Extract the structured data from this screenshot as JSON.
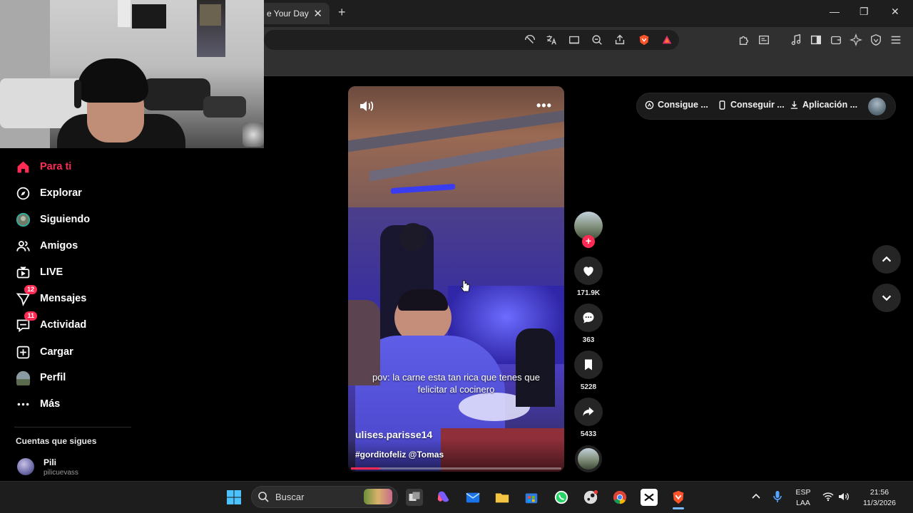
{
  "browser": {
    "tab_title": "e Your Day",
    "tab_close": "✕",
    "new_tab": "+",
    "window_controls": {
      "minimize": "—",
      "restore": "❐",
      "close": "✕"
    },
    "toolbar_icons": [
      "no-translate-icon",
      "translate-icon",
      "cast-icon",
      "zoom-icon",
      "share-icon",
      "brave-shields-icon",
      "brave-rewards-icon",
      "extensions-icon",
      "reader-icon",
      "media-icon",
      "sidebar-icon",
      "wallet-icon",
      "leo-icon",
      "vpn-icon",
      "menu-icon"
    ]
  },
  "sidebar": {
    "items": [
      {
        "label": "Para ti",
        "icon": "home-icon",
        "active": true
      },
      {
        "label": "Explorar",
        "icon": "compass-icon"
      },
      {
        "label": "Siguiendo",
        "icon": "following-avatar-icon"
      },
      {
        "label": "Amigos",
        "icon": "friends-icon"
      },
      {
        "label": "LIVE",
        "icon": "live-tv-icon"
      },
      {
        "label": "Mensajes",
        "icon": "send-icon",
        "badge": "12"
      },
      {
        "label": "Actividad",
        "icon": "activity-icon",
        "badge": "11"
      },
      {
        "label": "Cargar",
        "icon": "upload-icon"
      },
      {
        "label": "Perfil",
        "icon": "profile-avatar-icon"
      },
      {
        "label": "Más",
        "icon": "more-dots-icon"
      }
    ],
    "following_title": "Cuentas que sigues",
    "following": [
      {
        "name": "Pili",
        "username": "pilicuevass"
      }
    ]
  },
  "video": {
    "caption": "pov: la carne esta tan rica que tenes que felicitar al cocinero",
    "author": "ulises.parisse14",
    "tags": "#gorditofeliz @Tomas",
    "progress": 0.14,
    "more": "•••"
  },
  "actions": {
    "likes": "171.9K",
    "comments": "363",
    "saves": "5228",
    "shares": "5433",
    "follow_plus": "+"
  },
  "top_pill": {
    "items": [
      "Consigue ...",
      "Conseguir ...",
      "Aplicación ..."
    ]
  },
  "taskbar": {
    "search_placeholder": "Buscar",
    "language": "ESP",
    "layout": "LAA",
    "time": "21:56",
    "date": "11/3/2026"
  },
  "colors": {
    "accent": "#fe2c55",
    "background": "#000000",
    "chrome": "#303030"
  }
}
